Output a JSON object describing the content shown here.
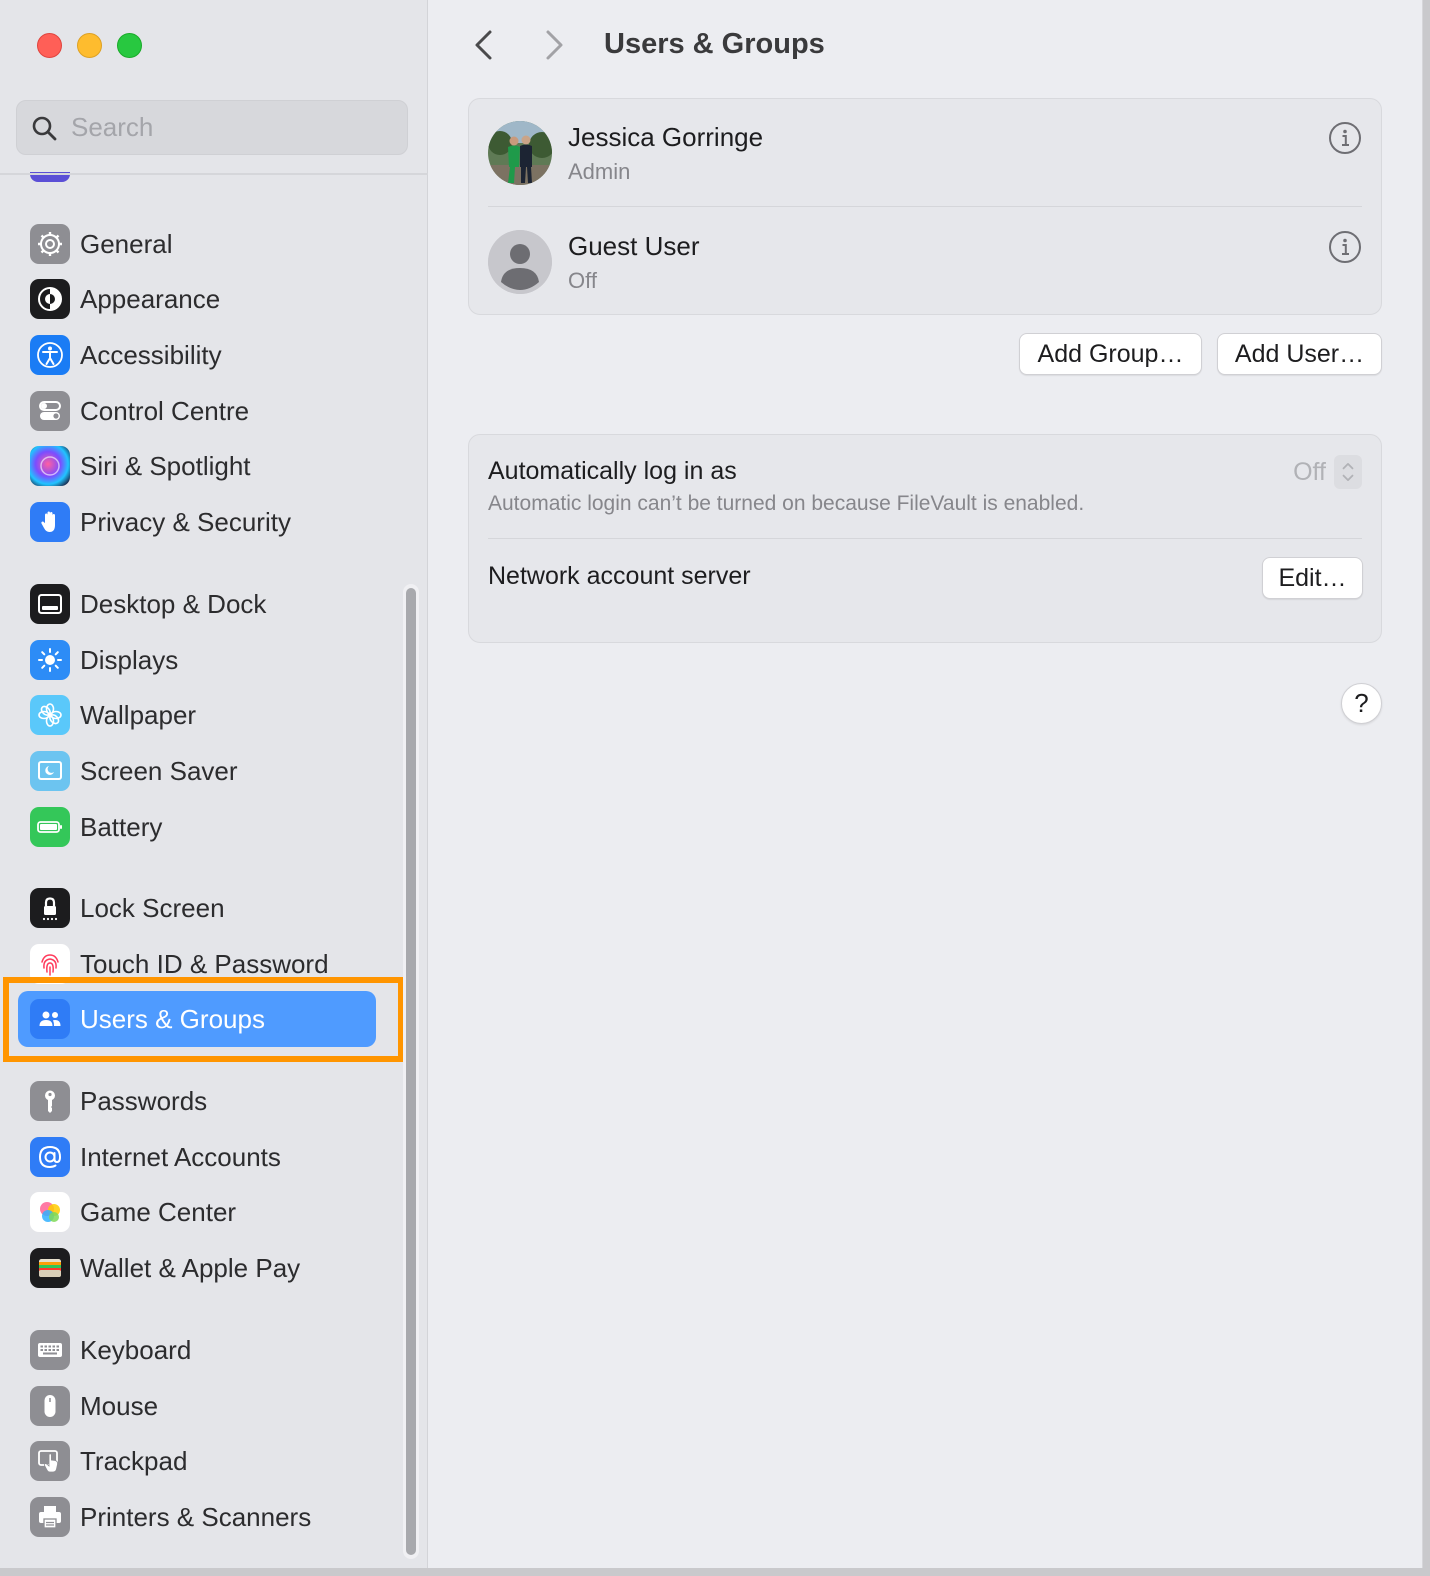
{
  "window": {
    "controls": [
      "close",
      "minimize",
      "zoom"
    ]
  },
  "search": {
    "placeholder": "Search"
  },
  "sidebar": {
    "groups": [
      [
        {
          "label": "General",
          "icon": "gear-icon",
          "color": "#8e8e93"
        },
        {
          "label": "Appearance",
          "icon": "appearance-icon",
          "color": "#1c1c1e"
        },
        {
          "label": "Accessibility",
          "icon": "accessibility-icon",
          "color": "#1a7cf5"
        },
        {
          "label": "Control Centre",
          "icon": "control-centre-icon",
          "color": "#8e8e93"
        },
        {
          "label": "Siri & Spotlight",
          "icon": "siri-icon",
          "color": "#2a2a5e"
        },
        {
          "label": "Privacy & Security",
          "icon": "hand-icon",
          "color": "#2f7cf6"
        }
      ],
      [
        {
          "label": "Desktop & Dock",
          "icon": "dock-icon",
          "color": "#1c1c1e"
        },
        {
          "label": "Displays",
          "icon": "sun-icon",
          "color": "#2d8cf6"
        },
        {
          "label": "Wallpaper",
          "icon": "flower-icon",
          "color": "#5ac8fa"
        },
        {
          "label": "Screen Saver",
          "icon": "screen-saver-icon",
          "color": "#6cc4f0"
        },
        {
          "label": "Battery",
          "icon": "battery-icon",
          "color": "#34c759"
        }
      ],
      [
        {
          "label": "Lock Screen",
          "icon": "lock-icon",
          "color": "#1c1c1e"
        },
        {
          "label": "Touch ID & Password",
          "icon": "fingerprint-icon",
          "color": "#ffffff"
        },
        {
          "label": "Users & Groups",
          "icon": "users-icon",
          "color": "#2f7cf6",
          "selected": true
        }
      ],
      [
        {
          "label": "Passwords",
          "icon": "key-icon",
          "color": "#8e8e93"
        },
        {
          "label": "Internet Accounts",
          "icon": "at-icon",
          "color": "#2f7cf6"
        },
        {
          "label": "Game Center",
          "icon": "game-center-icon",
          "color": "#ffffff"
        },
        {
          "label": "Wallet & Apple Pay",
          "icon": "wallet-icon",
          "color": "#1c1c1e"
        }
      ],
      [
        {
          "label": "Keyboard",
          "icon": "keyboard-icon",
          "color": "#8e8e93"
        },
        {
          "label": "Mouse",
          "icon": "mouse-icon",
          "color": "#8e8e93"
        },
        {
          "label": "Trackpad",
          "icon": "trackpad-icon",
          "color": "#8e8e93"
        },
        {
          "label": "Printers & Scanners",
          "icon": "printer-icon",
          "color": "#8e8e93"
        }
      ]
    ]
  },
  "header": {
    "title": "Users & Groups"
  },
  "users": [
    {
      "name": "Jessica Gorringe",
      "role": "Admin"
    },
    {
      "name": "Guest User",
      "role": "Off"
    }
  ],
  "actions": {
    "add_group": "Add Group…",
    "add_user": "Add User…"
  },
  "settings": {
    "auto_login": {
      "title": "Automatically log in as",
      "subtitle": "Automatic login can’t be turned on because FileVault is enabled.",
      "value": "Off"
    },
    "network_server": {
      "title": "Network account server",
      "button": "Edit…"
    }
  },
  "help": {
    "label": "?"
  },
  "colors": {
    "accent": "#4f9bff",
    "highlight": "#ff9500"
  }
}
